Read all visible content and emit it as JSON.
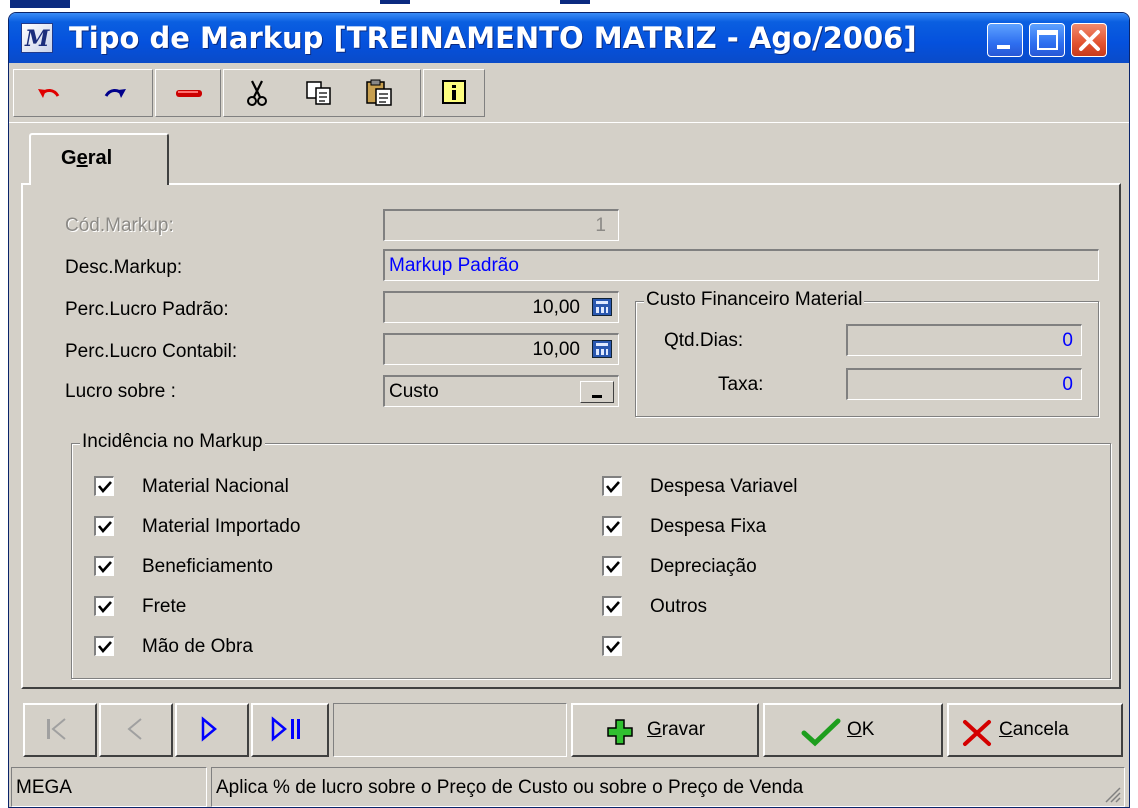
{
  "window": {
    "title": "Tipo de Markup [TREINAMENTO MATRIZ - Ago/2006]",
    "app_icon": "mega-logo-icon",
    "controls": [
      "minimize-icon",
      "maximize-icon",
      "close-icon"
    ]
  },
  "toolbar": {
    "tools": [
      "undo-icon",
      "redo-icon",
      "delete-icon",
      "cut-icon",
      "copy-icon",
      "paste-icon",
      "info-icon"
    ]
  },
  "tabs": [
    {
      "label_prefix": "G",
      "label_underline": "e",
      "label_suffix": "ral",
      "active": true
    }
  ],
  "form": {
    "cod_markup_label": "Cód.Markup:",
    "cod_markup_value": "1",
    "desc_markup_label": "Desc.Markup:",
    "desc_markup_value": "Markup Padrão",
    "perc_lucro_padrao_label": "Perc.Lucro Padrão:",
    "perc_lucro_padrao_value": "10,00",
    "perc_lucro_contabil_label": "Perc.Lucro Contabil:",
    "perc_lucro_contabil_value": "10,00",
    "lucro_sobre_label": "Lucro sobre :",
    "lucro_sobre_value": "Custo",
    "value_color": "#0000ff"
  },
  "custo_financeiro": {
    "legend": "Custo Financeiro Material",
    "qtd_dias_label": "Qtd.Dias:",
    "qtd_dias_value": "0",
    "taxa_label": "Taxa:",
    "taxa_value": "0"
  },
  "incidencia": {
    "legend": "Incidência no Markup",
    "left": [
      {
        "label": "Material Nacional",
        "checked": true
      },
      {
        "label": "Material Importado",
        "checked": true
      },
      {
        "label": "Beneficiamento",
        "checked": true
      },
      {
        "label": "Frete",
        "checked": true
      },
      {
        "label": "Mão de Obra",
        "checked": true
      }
    ],
    "right": [
      {
        "label": "Despesa Variavel",
        "checked": true
      },
      {
        "label": "Despesa Fixa",
        "checked": true
      },
      {
        "label": "Depreciação",
        "checked": true
      },
      {
        "label": "Outros",
        "checked": true
      },
      {
        "label": "",
        "checked": true
      }
    ]
  },
  "nav": {
    "buttons": [
      "first-record-icon",
      "prev-record-icon",
      "next-record-icon",
      "last-record-icon"
    ],
    "gravar_underline": "G",
    "gravar_rest": "ravar",
    "ok_underline": "O",
    "ok_rest": "K",
    "cancela_underline": "C",
    "cancela_rest": "ancela"
  },
  "status": {
    "left": "MEGA",
    "hint": "Aplica % de lucro sobre o Preço de Custo ou sobre o Preço de Venda"
  }
}
